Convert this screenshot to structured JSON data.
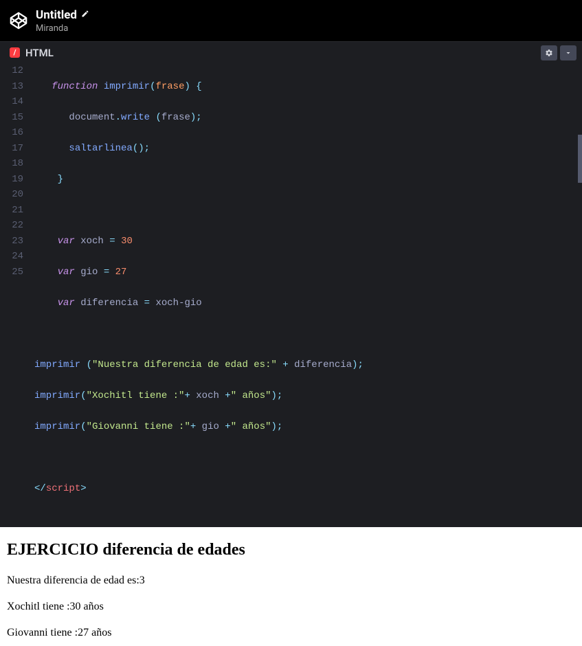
{
  "header": {
    "title": "Untitled",
    "author": "Miranda"
  },
  "tab": {
    "label": "HTML"
  },
  "gutter": {
    "lines": [
      "12",
      "13",
      "14",
      "15",
      "16",
      "17",
      "18",
      "19",
      "20",
      "21",
      "22",
      "23",
      "24",
      "25"
    ]
  },
  "code": {
    "l12_kw": "function",
    "l12_fn": "imprimir",
    "l12_p1": "(",
    "l12_arg": "frase",
    "l12_p2": ") {",
    "l13_obj": "document",
    "l13_dot": ".",
    "l13_meth": "write",
    "l13_sp": " (",
    "l13_arg": "frase",
    "l13_end": ");",
    "l14_fn": "saltarlinea",
    "l14_end": "();",
    "l15_brace": "}",
    "l17_kw": "var",
    "l17_name": " xoch ",
    "l17_eq": "= ",
    "l17_num": "30",
    "l18_kw": "var",
    "l18_name": " gio ",
    "l18_eq": "= ",
    "l18_num": "27",
    "l19_kw": "var",
    "l19_name": " diferencia ",
    "l19_eq": "= ",
    "l19_expr": "xoch-gio",
    "l21_fn": "imprimir",
    "l21_sp": " (",
    "l21_str": "\"Nuestra diferencia de edad es:\"",
    "l21_plus": " + ",
    "l21_var": "diferencia",
    "l21_end": ");",
    "l22_fn": "imprimir",
    "l22_p1": "(",
    "l22_str1": "\"Xochitl tiene :\"",
    "l22_plus1": "+ ",
    "l22_var": "xoch ",
    "l22_plus2": "+",
    "l22_str2": "\" años\"",
    "l22_end": ");",
    "l23_fn": "imprimir",
    "l23_p1": "(",
    "l23_str1": "\"Giovanni tiene :\"",
    "l23_plus1": "+ ",
    "l23_var": "gio ",
    "l23_plus2": "+",
    "l23_str2": "\" años\"",
    "l23_end": ");",
    "l25_open": "</",
    "l25_tag": "script",
    "l25_close": ">"
  },
  "output": {
    "heading": "EJERCICIO diferencia de edades",
    "line1": "Nuestra diferencia de edad es:3",
    "line2": "Xochitl tiene :30 años",
    "line3": "Giovanni tiene :27 años"
  }
}
